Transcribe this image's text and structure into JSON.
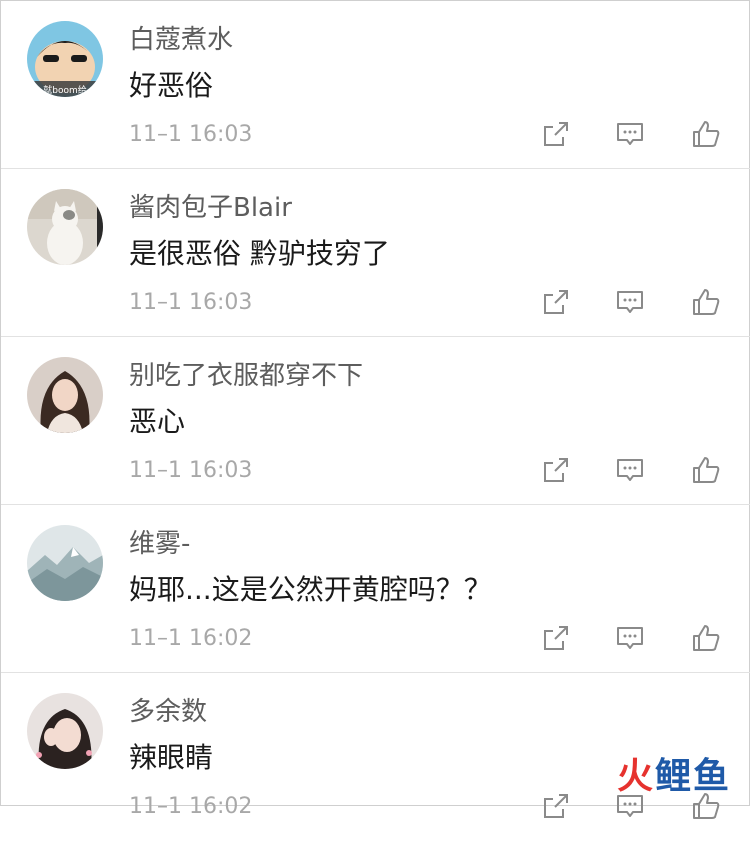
{
  "comments": [
    {
      "user": "白蔻煮水",
      "text": "好恶俗",
      "time": "11–1 16:03",
      "avatar_text": "就boom给"
    },
    {
      "user": "酱肉包子Blair",
      "text": "是很恶俗 黔驴技穷了",
      "time": "11–1 16:03"
    },
    {
      "user": "别吃了衣服都穿不下",
      "text": "恶心",
      "time": "11–1 16:03"
    },
    {
      "user": "维雾-",
      "text": "妈耶...这是公然开黄腔吗？？",
      "time": "11–1 16:02"
    },
    {
      "user": "多余数",
      "text": "辣眼睛",
      "time": "11–1 16:02"
    }
  ],
  "watermark": {
    "text": "火鲤鱼",
    "color_red": "#e6322e",
    "color_blue": "#1f5aa8"
  },
  "colors": {
    "name": "#5d5d5d",
    "text": "#1a1a1a",
    "time": "#a8a8a8",
    "icon": "#8a8a8a",
    "divider": "#e2e2e2"
  }
}
